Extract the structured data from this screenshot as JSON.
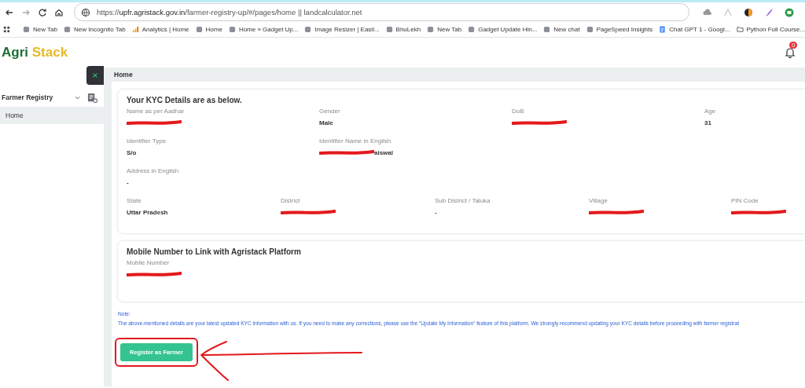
{
  "browser": {
    "url_scheme": "https://",
    "url_host": "upfr.agristack.gov.in",
    "url_path": "/farmer-registry-up/#/pages/home || landcalculator.net",
    "bookmarks": [
      {
        "label": "New Tab",
        "kind": "page"
      },
      {
        "label": "New Incognito Tab",
        "kind": "page"
      },
      {
        "label": "Analytics | Home",
        "kind": "chart"
      },
      {
        "label": "Home",
        "kind": "page"
      },
      {
        "label": "Home » Gadget Up...",
        "kind": "page"
      },
      {
        "label": "Image Resizer | Easil...",
        "kind": "page"
      },
      {
        "label": "BhuLekh",
        "kind": "page"
      },
      {
        "label": "New Tab",
        "kind": "page"
      },
      {
        "label": "Gadget Update Hin...",
        "kind": "page"
      },
      {
        "label": "New chat",
        "kind": "page"
      },
      {
        "label": "PageSpeed Insights",
        "kind": "page"
      },
      {
        "label": "Chat GPT 1 - Googl...",
        "kind": "doc"
      },
      {
        "label": "Python Full Course...",
        "kind": "folder"
      }
    ]
  },
  "header": {
    "logo_first": "Agri",
    "logo_second": "Stack",
    "notification_count": "0"
  },
  "sidebar": {
    "group": {
      "label": "Farmer Registry",
      "expanded": true,
      "items": [
        {
          "label": "Home",
          "selected": true
        }
      ]
    }
  },
  "breadcrumb": "Home",
  "kyc": {
    "title": "Your KYC Details are as below.",
    "rows": [
      [
        {
          "label": "Name as per Aadhar",
          "redacted": true
        },
        {
          "label": "Gender",
          "value": "Male",
          "redacted": false
        },
        {
          "label": "DoB",
          "redacted": true
        },
        {
          "label": "Age",
          "value": "31",
          "redacted": false
        }
      ],
      [
        {
          "label": "Identifier Type",
          "value": "S/o",
          "redacted": false
        },
        {
          "label": "Identifier Name in English",
          "value": "aiswal",
          "redacted": true
        }
      ],
      [
        {
          "label": "Address in English",
          "value": "-",
          "redacted": false
        }
      ],
      [
        {
          "label": "State",
          "value": "Uttar Pradesh",
          "redacted": false
        },
        {
          "label": "District",
          "redacted": true
        },
        {
          "label": "Sub District / Taluka",
          "value": "-",
          "redacted": false
        },
        {
          "label": "Village",
          "redacted": true
        },
        {
          "label": "PIN Code",
          "redacted": true
        }
      ]
    ]
  },
  "mobile": {
    "title": "Mobile Number to Link with Agristack Platform",
    "fields": [
      {
        "label": "Mobile Number",
        "redacted": true
      }
    ]
  },
  "note": {
    "heading": "Note:",
    "text": "The above-mentioned details are your latest updated KYC information with us. If you need to make any corrections, please use the \"Update My Information\" feature of this platform. We strongly recommend updating your KYC details before proceeding with farmer registrat"
  },
  "register_button": "Register as Farmer"
}
